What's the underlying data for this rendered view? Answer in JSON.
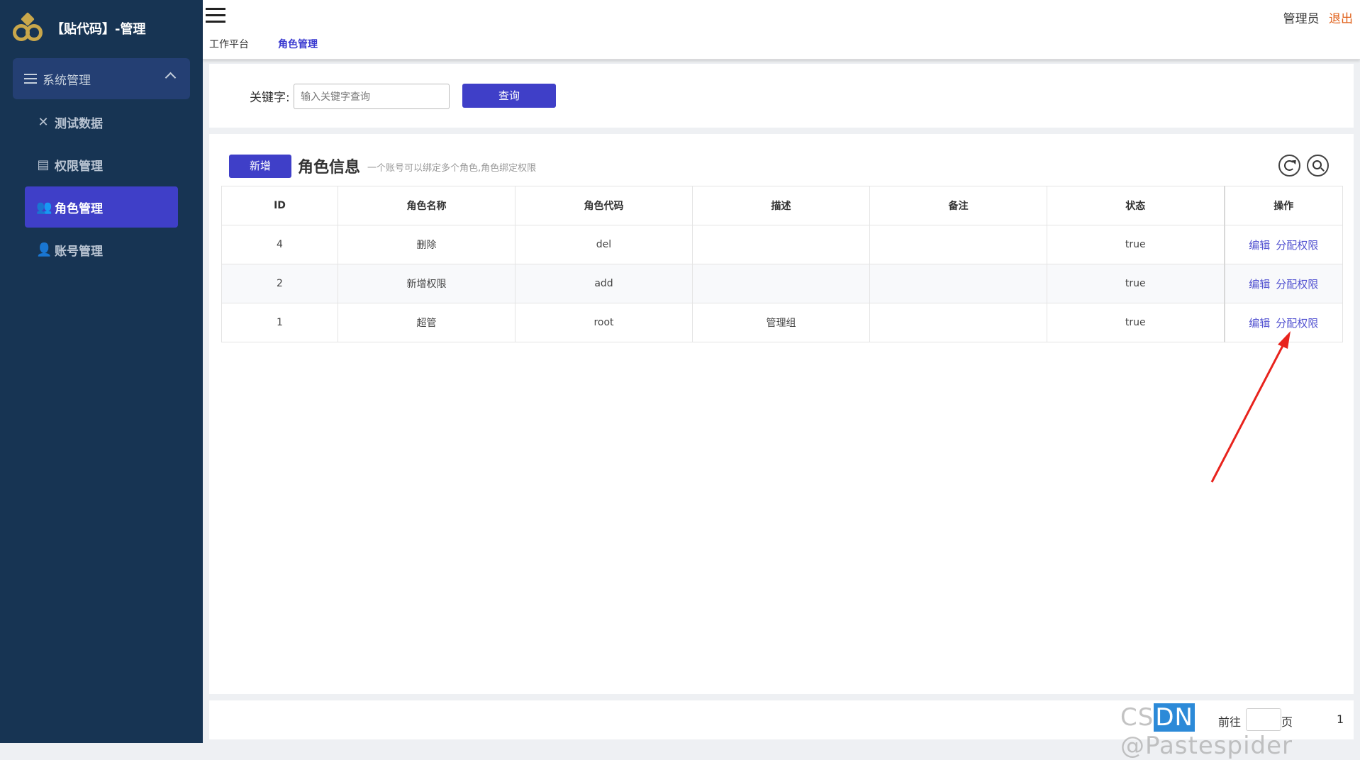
{
  "app": {
    "title": "【贴代码】-管理"
  },
  "sidebar": {
    "group_label": "系统管理",
    "items": [
      {
        "label": "测试数据",
        "icon": "close-icon"
      },
      {
        "label": "权限管理",
        "icon": "id-card-icon"
      },
      {
        "label": "角色管理",
        "icon": "users-icon",
        "active": true
      },
      {
        "label": "账号管理",
        "icon": "user-icon"
      }
    ]
  },
  "header": {
    "tabs": [
      {
        "label": "工作平台"
      },
      {
        "label": "角色管理",
        "active": true
      }
    ],
    "user": {
      "admin": "管理员",
      "logout": "退出"
    }
  },
  "search": {
    "label": "关键字:",
    "placeholder": "输入关键字查询",
    "button": "查询"
  },
  "section": {
    "add_button": "新增",
    "title": "角色信息",
    "subtitle": "一个账号可以绑定多个角色,角色绑定权限"
  },
  "table": {
    "columns": [
      "ID",
      "角色名称",
      "角色代码",
      "描述",
      "备注",
      "状态",
      "操作"
    ],
    "rows": [
      {
        "id": "4",
        "name": "删除",
        "code": "del",
        "desc": "",
        "remark": "",
        "status": "true",
        "edit": "编辑",
        "assign": "分配权限"
      },
      {
        "id": "2",
        "name": "新增权限",
        "code": "add",
        "desc": "",
        "remark": "",
        "status": "true",
        "edit": "编辑",
        "assign": "分配权限"
      },
      {
        "id": "1",
        "name": "超管",
        "code": "root",
        "desc": "管理组",
        "remark": "",
        "status": "true",
        "edit": "编辑",
        "assign": "分配权限"
      }
    ]
  },
  "pager": {
    "goto": "前往",
    "page_suffix": "页",
    "page_number": "1"
  },
  "watermark": {
    "prefix": "CS",
    "highlight": "DN",
    "suffix": " @Pastespider"
  },
  "colors": {
    "sidebar": "#173453",
    "accent": "#3f3fc8",
    "logout": "#e0601a",
    "arrow": "#e8231d"
  }
}
